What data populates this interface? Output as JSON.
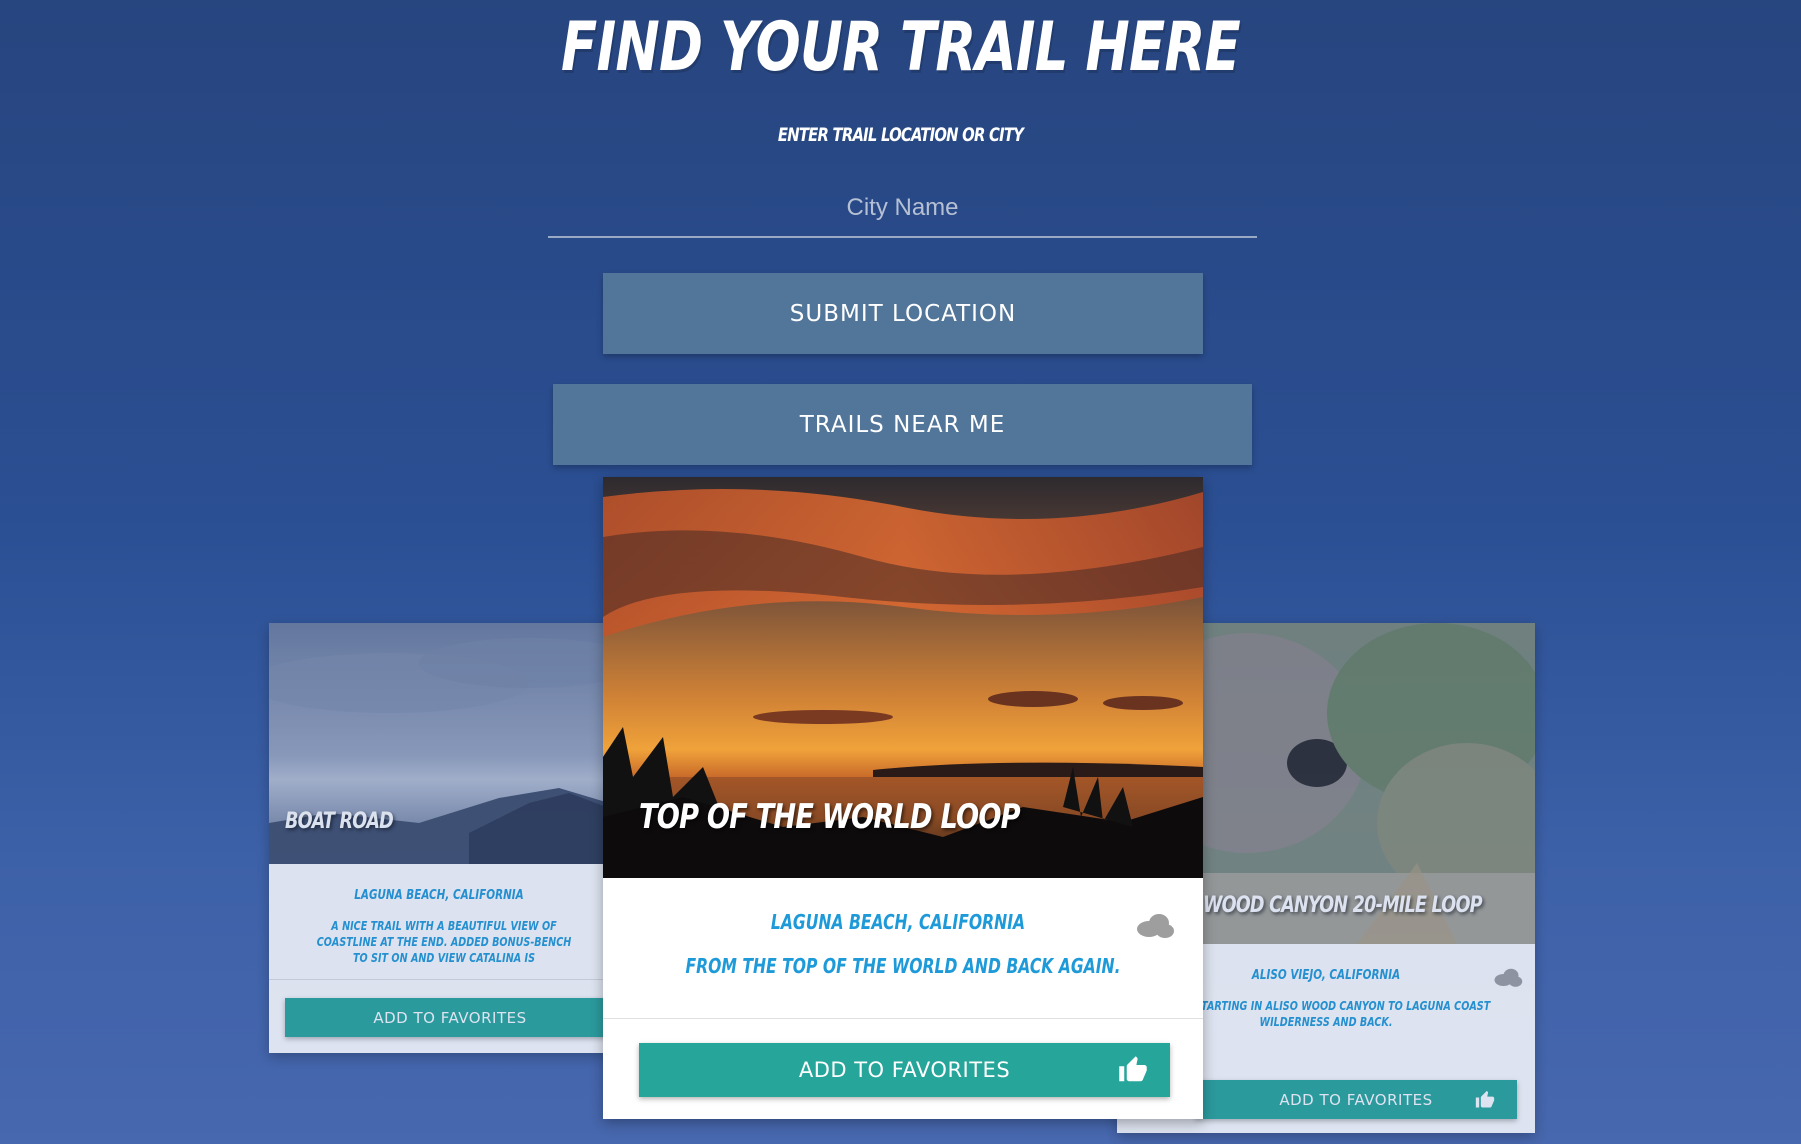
{
  "header": {
    "title": "Find Your Trail Here",
    "subtitle": "Enter Trail Location or City"
  },
  "search": {
    "placeholder": "City Name"
  },
  "buttons": {
    "submit_label": "SUBMIT LOCATION",
    "near_label": "TRAILS NEAR ME"
  },
  "cards": {
    "left": {
      "name": "Boat Road",
      "location": "LAGUNA BEACH, CALIFORNIA",
      "description": "A NICE TRAIL WITH A BEAUTIFUL VIEW OF COASTLINE AT THE END. ADDED BONUS-BENCH TO SIT ON AND VIEW CATALINA IS",
      "fav_label": "ADD TO FAVORITES",
      "weather_icon": "cloud-icon"
    },
    "center": {
      "name": "Top of the World Loop",
      "location": "LAGUNA BEACH, CALIFORNIA",
      "description": "FROM THE TOP OF THE WORLD AND BACK AGAIN.",
      "fav_label": "ADD TO FAVORITES",
      "weather_icon": "cloud-icon"
    },
    "right": {
      "name": "Wood Canyon 20-Mile Loop",
      "location": "ALISO VIEJO, CALIFORNIA",
      "description": "LOOP STARTING IN ALISO WOOD CANYON TO LAGUNA COAST WILDERNESS AND BACK.",
      "fav_label": "ADD TO FAVORITES",
      "weather_icon": "cloud-icon"
    }
  },
  "colors": {
    "accent": "#26a69a",
    "button": "#52759a",
    "text_blue": "#1f9ad9"
  }
}
